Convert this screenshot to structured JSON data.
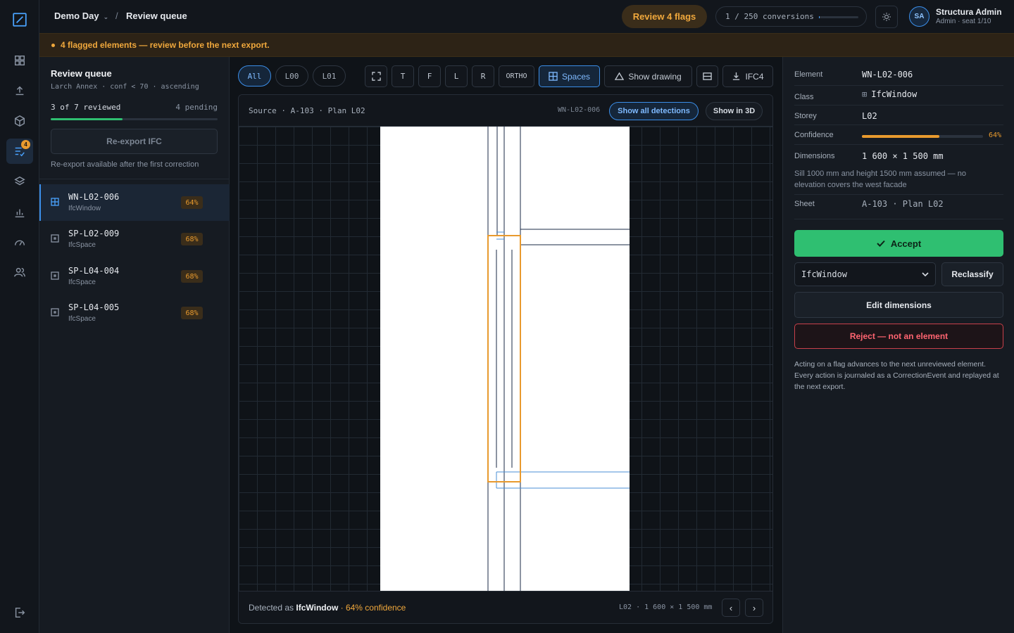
{
  "app": {
    "logo": "diagonal-square-icon"
  },
  "rail": {
    "items": [
      {
        "icon": "grid-icon"
      },
      {
        "icon": "upload-icon"
      },
      {
        "icon": "cube-icon"
      },
      {
        "icon": "checklist-icon",
        "badge": "4"
      },
      {
        "icon": "layers-icon"
      },
      {
        "icon": "bar-chart-icon"
      },
      {
        "icon": "gauge-icon"
      },
      {
        "icon": "users-icon"
      }
    ],
    "logout_icon": "logout-icon"
  },
  "header": {
    "project": "Demo Day",
    "separator": "/",
    "page": "Review queue",
    "review_flags": "Review 4 flags",
    "conversions": "1 / 250 conversions",
    "conversions_progress": 0.004,
    "user_initials": "SA",
    "user_name": "Structura Admin",
    "user_role": "Admin · seat 1/10"
  },
  "banner": {
    "text": "4 flagged elements — review before the next export."
  },
  "queue": {
    "title": "Review queue",
    "filter": "Larch Annex · conf < 70 · ascending",
    "reviewed": "3 of 7 reviewed",
    "pending": "4 pending",
    "progress": 0.43,
    "reexport_label": "Re-export IFC",
    "reexport_note": "Re-export available after the first correction",
    "items": [
      {
        "id": "WN-L02-006",
        "class": "IfcWindow",
        "conf": "64%",
        "icon": "window-icon"
      },
      {
        "id": "SP-L02-009",
        "class": "IfcSpace",
        "conf": "68%",
        "icon": "space-icon"
      },
      {
        "id": "SP-L04-004",
        "class": "IfcSpace",
        "conf": "68%",
        "icon": "space-icon"
      },
      {
        "id": "SP-L04-005",
        "class": "IfcSpace",
        "conf": "68%",
        "icon": "space-icon"
      }
    ]
  },
  "toolbar": {
    "levels": [
      "All",
      "L00",
      "L01"
    ],
    "views": [
      "T",
      "F",
      "L",
      "R",
      "ORTHO"
    ],
    "spaces": "Spaces",
    "show_drawing": "Show drawing",
    "export": "IFC4"
  },
  "viewer": {
    "source": "Source · A-103 · Plan L02",
    "element": "WN-L02-006",
    "show_all": "Show all detections",
    "show_3d": "Show in 3D",
    "detected_prefix": "Detected as",
    "detected_class": "IfcWindow",
    "detected_conf": "· 64% confidence",
    "footer_meta": "L02 · 1 600 × 1 500 mm",
    "prev": "‹",
    "next": "›"
  },
  "inspector": {
    "element_label": "Element",
    "element": "WN-L02-006",
    "class_label": "Class",
    "class": "IfcWindow",
    "storey_label": "Storey",
    "storey": "L02",
    "confidence_label": "Confidence",
    "confidence": 0.64,
    "confidence_text": "64%",
    "dimensions_label": "Dimensions",
    "dimensions": "1 600 × 1 500 mm",
    "dim_note": "Sill 1000 mm and height 1500 mm assumed — no elevation covers the west facade",
    "sheet_label": "Sheet",
    "sheet": "A-103 · Plan L02",
    "accept": "Accept",
    "select_value": "IfcWindow",
    "reclassify": "Reclassify",
    "edit_dims": "Edit dimensions",
    "reject": "Reject — not an element",
    "note": "Acting on a flag advances to the next unreviewed element. Every action is journaled as a CorrectionEvent and replayed at the next export."
  },
  "colors": {
    "accent": "#3b8ee8",
    "warning": "#f0a83c",
    "success": "#2fbf71",
    "danger": "#ff6470"
  }
}
